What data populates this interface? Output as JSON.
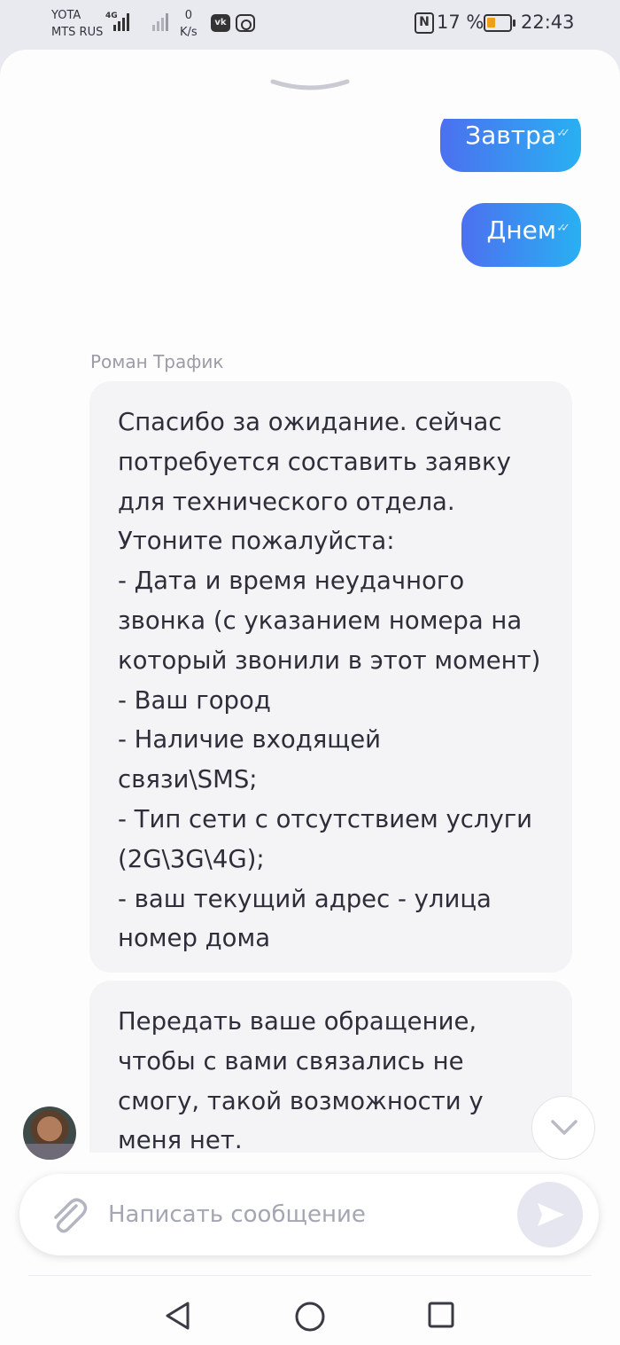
{
  "status_bar": {
    "carrier_1": "YOTA",
    "carrier_2": "MTS RUS",
    "net_type": "4G",
    "speed_value": "0",
    "speed_unit": "K/s",
    "battery_text": "17 %",
    "battery_level": 0.17,
    "battery_color": "#f29d16",
    "time": "22:43",
    "icons": [
      "signal-icon",
      "vk-icon",
      "instagram-icon",
      "nfc-icon",
      "battery-icon"
    ]
  },
  "chat": {
    "outgoing": [
      {
        "text": "Завтра"
      },
      {
        "text": "Днем"
      }
    ],
    "sender_name": "Роман Трафик",
    "incoming": [
      {
        "text": "Спасибо за ожидание. сейчас\nпотребуется составить заявку\nдля технического отдела.\nУтоните пожалуйста:\n- Дата и время неудачного\nзвонка (с указанием номера на\nкоторый звонили в этот момент)\n- Ваш город\n- Наличие входящей\nсвязи\\SMS;\n- Тип сети с отсутствием услуги\n(2G\\3G\\4G);\n- ваш текущий адрес - улица\nномер дома"
      },
      {
        "text": "Передать ваше обращение,\nчтобы с вами связались не\nсмогу, такой возможности у\nменя нет.\nВсе вопросы решаются в чате."
      }
    ]
  },
  "composer": {
    "placeholder": "Написать сообщение",
    "value": ""
  },
  "colors": {
    "accent_start": "#4c70f0",
    "accent_end": "#29b0f2",
    "incoming_bg": "#f4f4f6"
  }
}
